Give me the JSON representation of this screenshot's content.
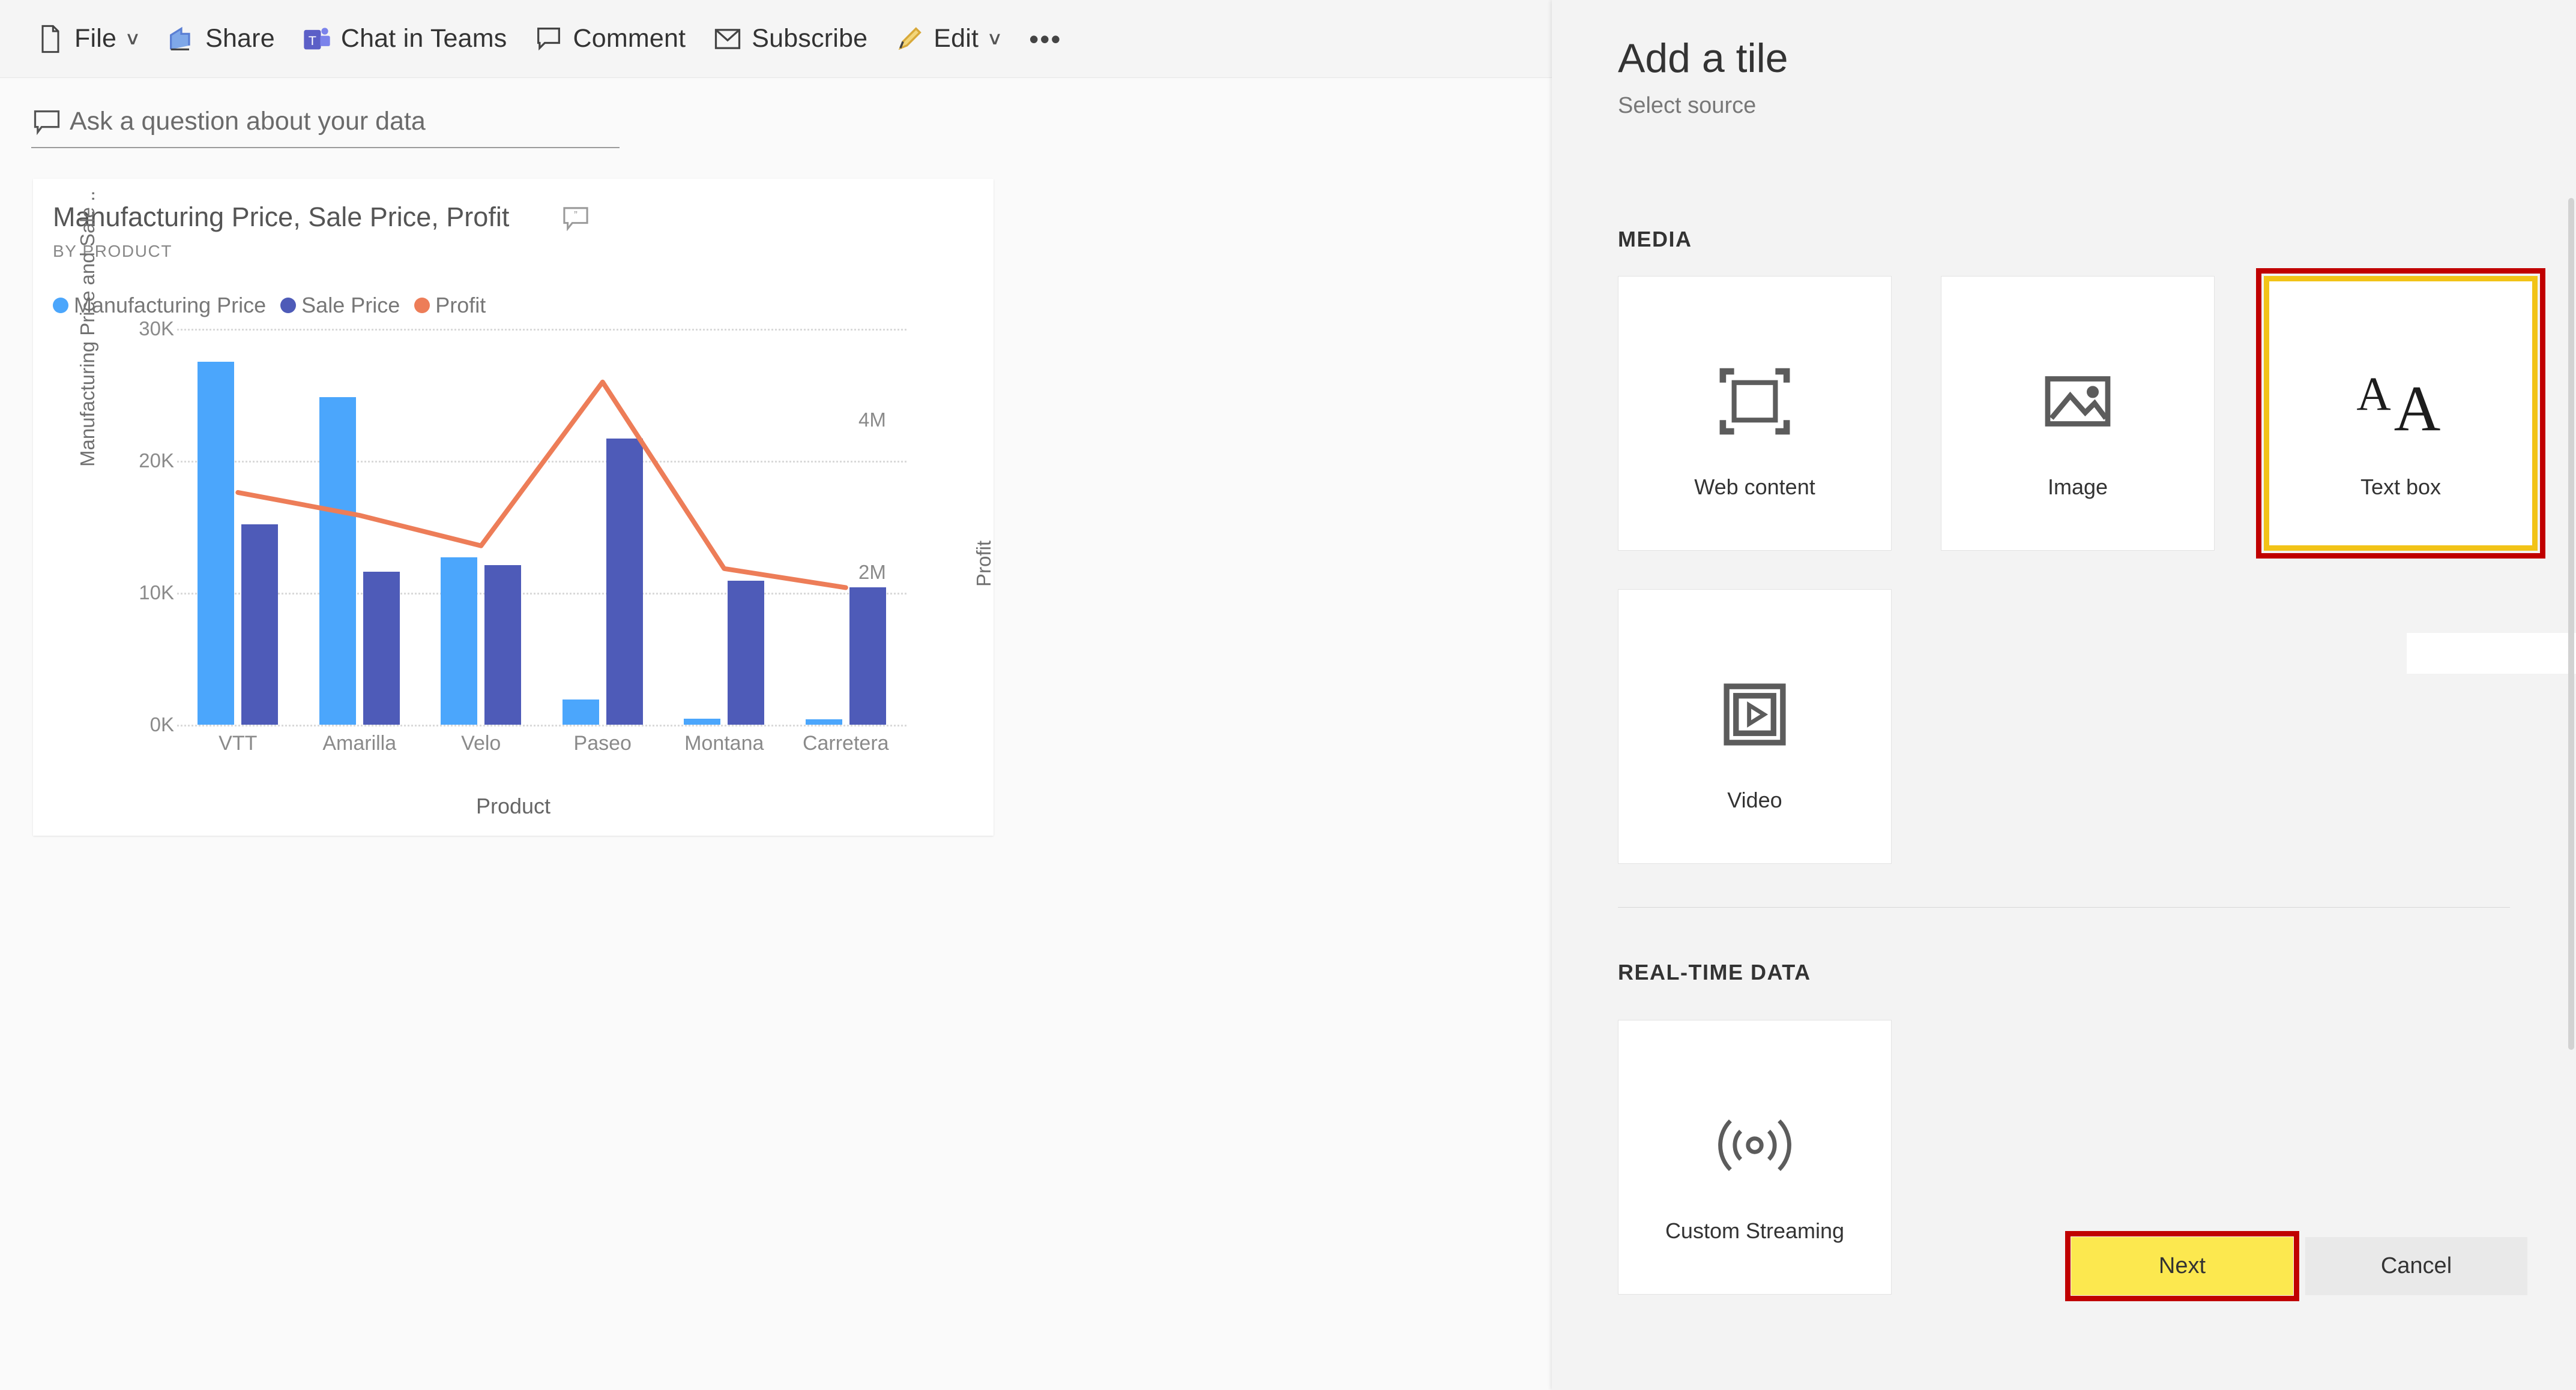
{
  "toolbar": {
    "items": [
      {
        "label": "File",
        "icon": "file-icon",
        "caret": true
      },
      {
        "label": "Share",
        "icon": "share-icon",
        "caret": false
      },
      {
        "label": "Chat in Teams",
        "icon": "teams-icon",
        "caret": false
      },
      {
        "label": "Comment",
        "icon": "comment-icon",
        "caret": false
      },
      {
        "label": "Subscribe",
        "icon": "envelope-icon",
        "caret": false
      },
      {
        "label": "Edit",
        "icon": "pencil-icon",
        "caret": true
      }
    ],
    "more_label": "•••"
  },
  "qna": {
    "placeholder": "Ask a question about your data"
  },
  "chart_data": {
    "type": "bar",
    "title": "Manufacturing Price, Sale Price, Profit",
    "subtitle": "BY PRODUCT",
    "xlabel": "Product",
    "ylabel": "Manufacturing Price and Sale ..",
    "y2label": "Profit",
    "categories": [
      "VTT",
      "Amarilla",
      "Velo",
      "Paseo",
      "Montana",
      "Carretera"
    ],
    "series": [
      {
        "name": "Manufacturing Price",
        "type": "bar",
        "axis": "left",
        "color": "#4ba6fc",
        "values": [
          27500,
          24800,
          12700,
          1900,
          450,
          400
        ]
      },
      {
        "name": "Sale Price",
        "type": "bar",
        "axis": "left",
        "color": "#4e5bb8",
        "values": [
          15200,
          11600,
          12100,
          21700,
          10900,
          10400
        ]
      },
      {
        "name": "Profit",
        "type": "line",
        "axis": "right",
        "color": "#ed7d58",
        "values": [
          3050000,
          2750000,
          2350000,
          4500000,
          2050000,
          1800000
        ]
      }
    ],
    "yticks_left": [
      "30K",
      "20K",
      "10K",
      "0K"
    ],
    "yticks_left_values": [
      30000,
      20000,
      10000,
      0
    ],
    "ylim": [
      0,
      30000
    ],
    "yticks_right": [
      "4M",
      "2M"
    ],
    "yticks_right_values": [
      4000000,
      2000000
    ],
    "y2lim": [
      0,
      5200000
    ],
    "grid": true,
    "legend_position": "top-left",
    "legend": [
      "Manufacturing Price",
      "Sale Price",
      "Profit"
    ]
  },
  "panel": {
    "title": "Add a tile",
    "subtitle": "Select source",
    "sections": [
      {
        "heading": "MEDIA",
        "tiles": [
          {
            "label": "Web content",
            "icon": "web-content-icon",
            "selected": false
          },
          {
            "label": "Image",
            "icon": "image-icon",
            "selected": false
          },
          {
            "label": "Text box",
            "icon": "text-box-icon",
            "selected": true
          },
          {
            "label": "Video",
            "icon": "video-icon",
            "selected": false
          }
        ]
      },
      {
        "heading": "REAL-TIME DATA",
        "tiles": [
          {
            "label": "Custom Streaming",
            "icon": "streaming-icon",
            "selected": false
          }
        ]
      }
    ],
    "footer": {
      "next_label": "Next",
      "cancel_label": "Cancel"
    }
  },
  "colors": {
    "highlight_red": "#c00000",
    "highlight_yellow": "#f2c317",
    "next_button_bg": "#fce84f",
    "series_manufacturing": "#4ba6fc",
    "series_sale": "#4e5bb8",
    "series_profit": "#ed7d58",
    "panel_bg": "#f3f3f3"
  }
}
